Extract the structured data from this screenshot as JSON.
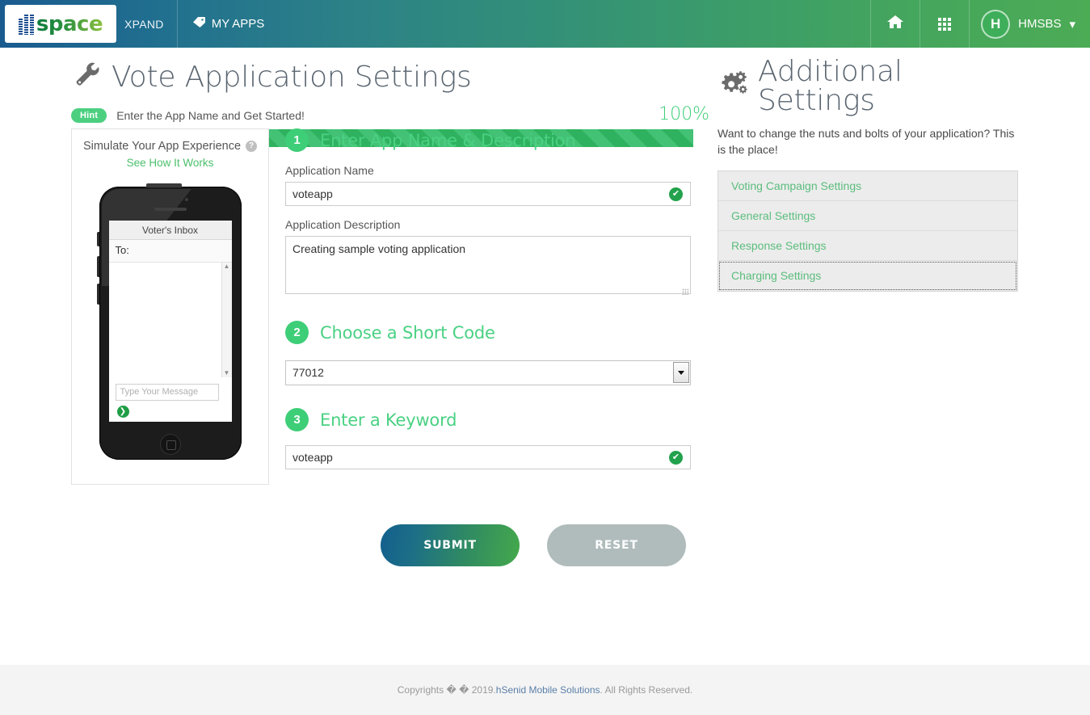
{
  "nav": {
    "logo_text": "space",
    "logo_suffix": "XPAND",
    "my_apps": "MY APPS",
    "my_apps_icon": "tag-icon",
    "home_icon": "home-icon",
    "apps_grid_icon": "grid-icon",
    "avatar_initial": "H",
    "username": "HMSBS",
    "caret": "▾"
  },
  "page": {
    "title": "Vote Application Settings",
    "title_icon": "wrench-icon",
    "hint_badge": "Hint",
    "hint_text": "Enter the App Name and Get Started!",
    "progress_percent": "100%",
    "progress_value": 100
  },
  "simulator": {
    "title": "Simulate Your App Experience",
    "help_icon": "question-mark-icon",
    "help_glyph": "?",
    "link": "See How It Works",
    "inbox_title": "Voter's Inbox",
    "to_label": "To:",
    "message_placeholder": "Type Your Message",
    "send_icon": "send-arrow-icon",
    "send_glyph": "❯",
    "scroll_up_glyph": "▲",
    "scroll_down_glyph": "▼"
  },
  "form": {
    "step1": {
      "number": "1",
      "label": "Enter App Name & Description",
      "app_name_label": "Application Name",
      "app_name_value": "voteapp",
      "app_name_valid_icon": "check-circle-icon",
      "check_glyph": "✔",
      "app_desc_label": "Application Description",
      "app_desc_value": "Creating sample voting application"
    },
    "step2": {
      "number": "2",
      "label": "Choose a Short Code",
      "selected": "77012",
      "options": [
        "77012"
      ],
      "dropdown_icon": "chevron-down-icon"
    },
    "step3": {
      "number": "3",
      "label": "Enter a Keyword",
      "keyword_value": "voteapp",
      "keyword_valid_icon": "check-circle-icon",
      "check_glyph": "✔"
    },
    "submit_label": "SUBMIT",
    "reset_label": "RESET"
  },
  "additional": {
    "title": "Additional Settings",
    "title_icon": "gears-icon",
    "description": "Want to change the nuts and bolts of your application? This is the place!",
    "items": [
      {
        "label": "Voting Campaign Settings"
      },
      {
        "label": "General Settings"
      },
      {
        "label": "Response Settings"
      },
      {
        "label": "Charging Settings"
      }
    ]
  },
  "footer": {
    "prefix": "Copyrights � � 2019. ",
    "link": "hSenid Mobile Solutions",
    "suffix": ". All Rights Reserved."
  },
  "colors": {
    "accent_green": "#3ece78",
    "nav_blue": "#1a5b8f",
    "nav_green": "#4cab55",
    "link_green": "#5bbd7d"
  }
}
